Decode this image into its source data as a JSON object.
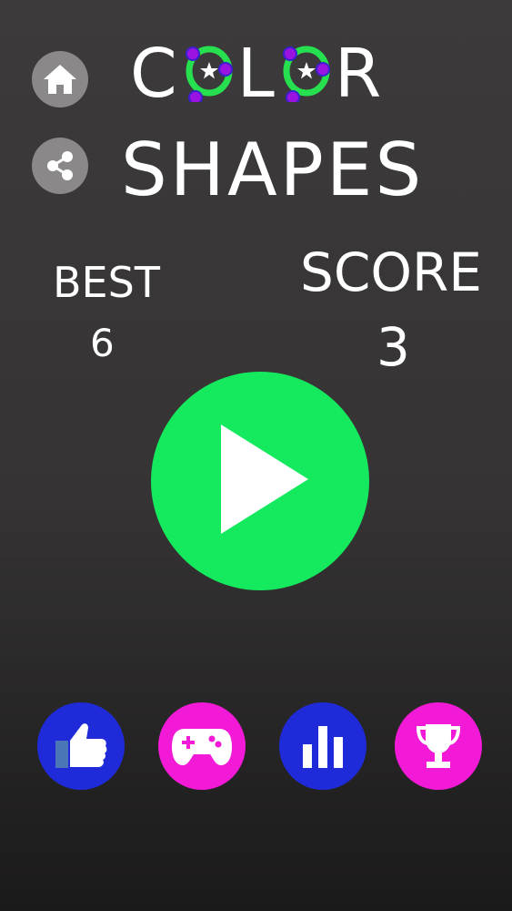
{
  "title": {
    "line1_part1": "C",
    "line1_part2": "L",
    "line1_part3": "R",
    "line2": "SHAPES"
  },
  "stats": {
    "best_label": "BEST",
    "best_value": "6",
    "score_label": "SCORE",
    "score_value": "3"
  },
  "icons": {
    "home": "home-icon",
    "share": "share-icon",
    "play": "play-icon",
    "like": "thumbs-up-icon",
    "games": "gamepad-icon",
    "leaderboard": "bar-chart-icon",
    "achievements": "trophy-icon"
  },
  "colors": {
    "background": "#3c3a3a",
    "play": "#15ea5e",
    "like": "#1f2bd8",
    "games": "#f21ad6",
    "leaderboard": "#1f2bd8",
    "achievements": "#f21ad6",
    "ring_green": "#26e04f",
    "ring_dot": "#9a13e0",
    "side_button": "#8a8888"
  }
}
